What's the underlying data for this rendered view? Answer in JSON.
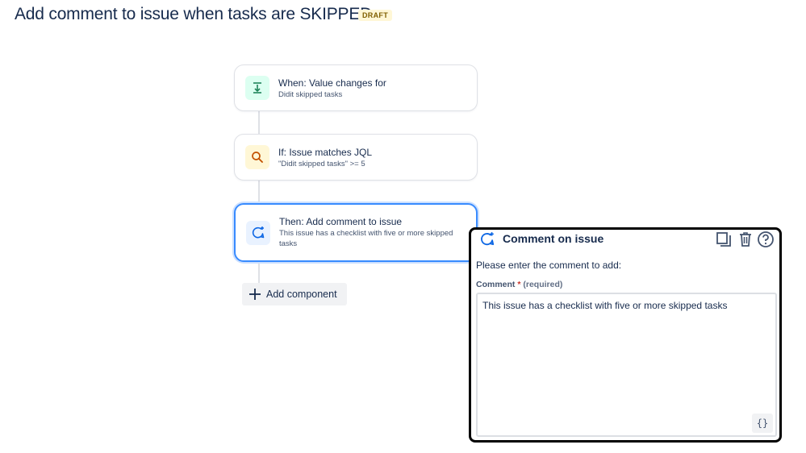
{
  "header": {
    "title": "Add comment to issue when tasks are SKIPPED",
    "status_badge": "DRAFT"
  },
  "flow": {
    "components": [
      {
        "title": "When: Value changes for",
        "subtitle": "Didit skipped tasks",
        "icon": "trigger-icon",
        "accent": "#dcfff1"
      },
      {
        "title": "If: Issue matches JQL",
        "subtitle": "\"Didit skipped tasks\" >= 5",
        "icon": "search-icon",
        "accent": "#fff7d6"
      },
      {
        "title": "Then: Add comment to issue",
        "subtitle": "This issue has a checklist with five or more skipped tasks",
        "icon": "comment-add-icon",
        "accent": "#e9f2ff",
        "selected": true
      }
    ],
    "add_component_label": "Add component"
  },
  "panel": {
    "title": "Comment on issue",
    "icon": "comment-add-icon",
    "tools": [
      "duplicate-icon",
      "trash-icon",
      "help-icon"
    ],
    "description": "Please enter the comment to add:",
    "field_label": "Comment",
    "required_marker": "*",
    "required_text": "(required)",
    "comment_value": "This issue has a checklist with five or more skipped tasks",
    "smart_values_button": "{}"
  }
}
